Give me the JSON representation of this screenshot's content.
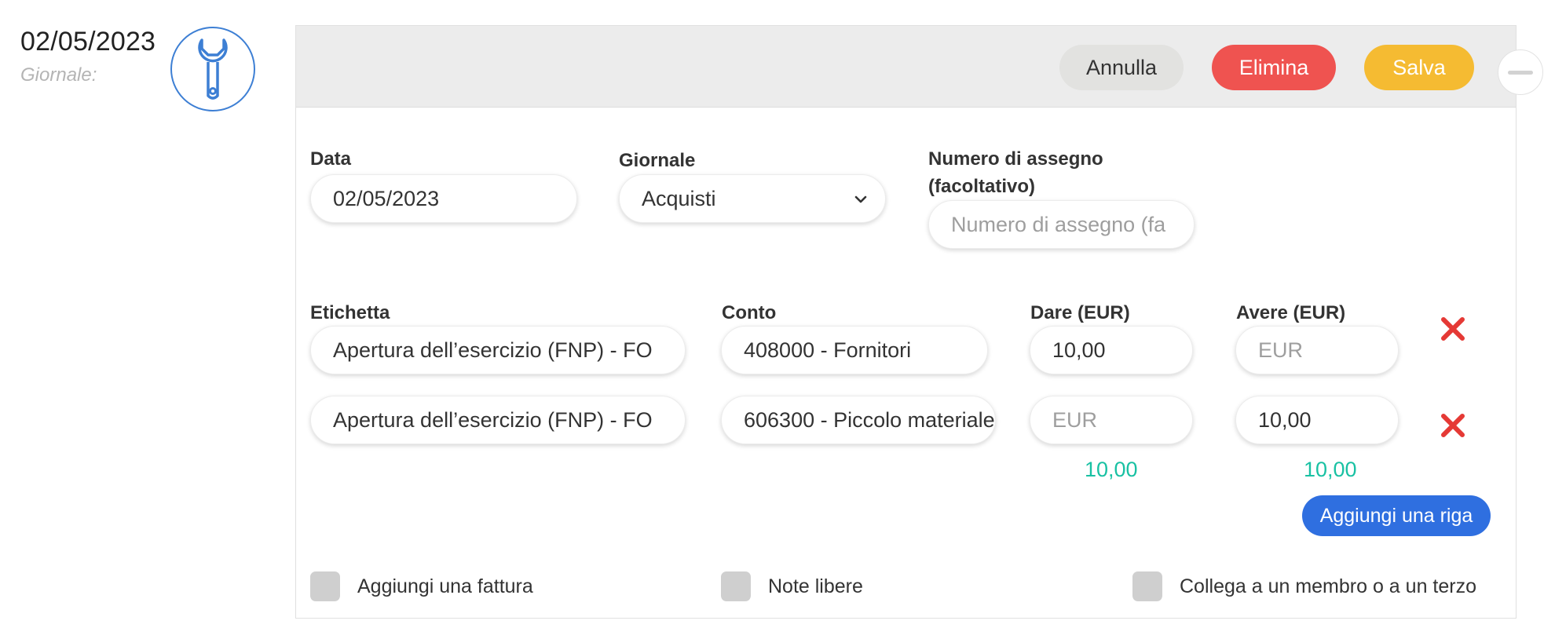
{
  "summary": {
    "date": "02/05/2023",
    "journal_label": "Giornale:"
  },
  "header": {
    "cancel_label": "Annulla",
    "delete_label": "Elimina",
    "save_label": "Salva"
  },
  "form": {
    "date_label": "Data",
    "date_value": "02/05/2023",
    "journal_label": "Giornale",
    "journal_value": "Acquisti",
    "check_label_line1": "Numero di assegno",
    "check_label_line2": "(facoltativo)",
    "check_placeholder": "Numero di assegno (fa"
  },
  "lines": {
    "columns": [
      "Etichetta",
      "Conto",
      "Dare (EUR)",
      "Avere (EUR)"
    ],
    "currency_placeholder": "EUR",
    "rows": [
      {
        "label": "Apertura dell’esercizio (FNP) - FO",
        "account": "408000 - Fornitori",
        "debit": "10,00",
        "credit": ""
      },
      {
        "label": "Apertura dell’esercizio (FNP) - FO",
        "account": "606300 - Piccolo materiale",
        "debit": "",
        "credit": "10,00"
      }
    ],
    "total_debit": "10,00",
    "total_credit": "10,00",
    "add_row_label": "Aggiungi una riga"
  },
  "options": {
    "invoice_label": "Aggiungi una fattura",
    "notes_label": "Note libere",
    "link_label": "Collega a un membro o a un terzo"
  },
  "colors": {
    "delete": "#ef5350",
    "save": "#f5bb32",
    "primary": "#2f6fe0",
    "total": "#19c1a3",
    "icon": "#3d7fd4",
    "remove": "#e53935"
  },
  "icons": {
    "tool": "wrench-icon",
    "remove": "close-icon",
    "collapse": "minus-icon",
    "select": "chevron-down-icon"
  }
}
